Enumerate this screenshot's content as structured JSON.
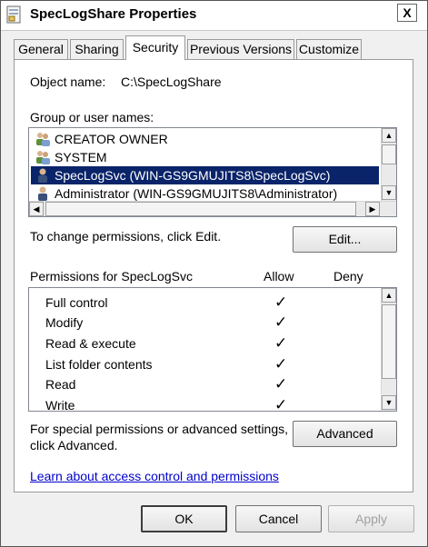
{
  "window": {
    "title": "SpecLogShare Properties",
    "close_glyph": "X"
  },
  "tabs": [
    {
      "label": "General"
    },
    {
      "label": "Sharing"
    },
    {
      "label": "Security"
    },
    {
      "label": "Previous Versions"
    },
    {
      "label": "Customize"
    }
  ],
  "active_tab": "Security",
  "security": {
    "object_name_label": "Object name:",
    "object_name_value": "C:\\SpecLogShare",
    "group_label": "Group or user names:",
    "users": [
      {
        "name": "CREATOR OWNER",
        "icon": "group-icon",
        "selected": false
      },
      {
        "name": "SYSTEM",
        "icon": "group-icon",
        "selected": false
      },
      {
        "name": "SpecLogSvc (WIN-GS9GMUJITS8\\SpecLogSvc)",
        "icon": "user-icon",
        "selected": true
      },
      {
        "name": "Administrator (WIN-GS9GMUJITS8\\Administrator)",
        "icon": "user-icon",
        "selected": false
      }
    ],
    "change_text": "To change permissions, click Edit.",
    "edit_button": "Edit...",
    "permissions_label": "Permissions for SpecLogSvc",
    "allow_header": "Allow",
    "deny_header": "Deny",
    "permissions": [
      {
        "name": "Full control",
        "allow": "✓",
        "deny": ""
      },
      {
        "name": "Modify",
        "allow": "✓",
        "deny": ""
      },
      {
        "name": "Read & execute",
        "allow": "✓",
        "deny": ""
      },
      {
        "name": "List folder contents",
        "allow": "✓",
        "deny": ""
      },
      {
        "name": "Read",
        "allow": "✓",
        "deny": ""
      },
      {
        "name": "Write",
        "allow": "✓",
        "deny": ""
      }
    ],
    "special_text_line1": "For special permissions or advanced settings,",
    "special_text_line2": "click Advanced.",
    "advanced_button": "Advanced",
    "learn_link": "Learn about access control and permissions"
  },
  "footer": {
    "ok": "OK",
    "cancel": "Cancel",
    "apply": "Apply"
  },
  "colors": {
    "selection": "#0a246a",
    "link": "#0000cc"
  }
}
